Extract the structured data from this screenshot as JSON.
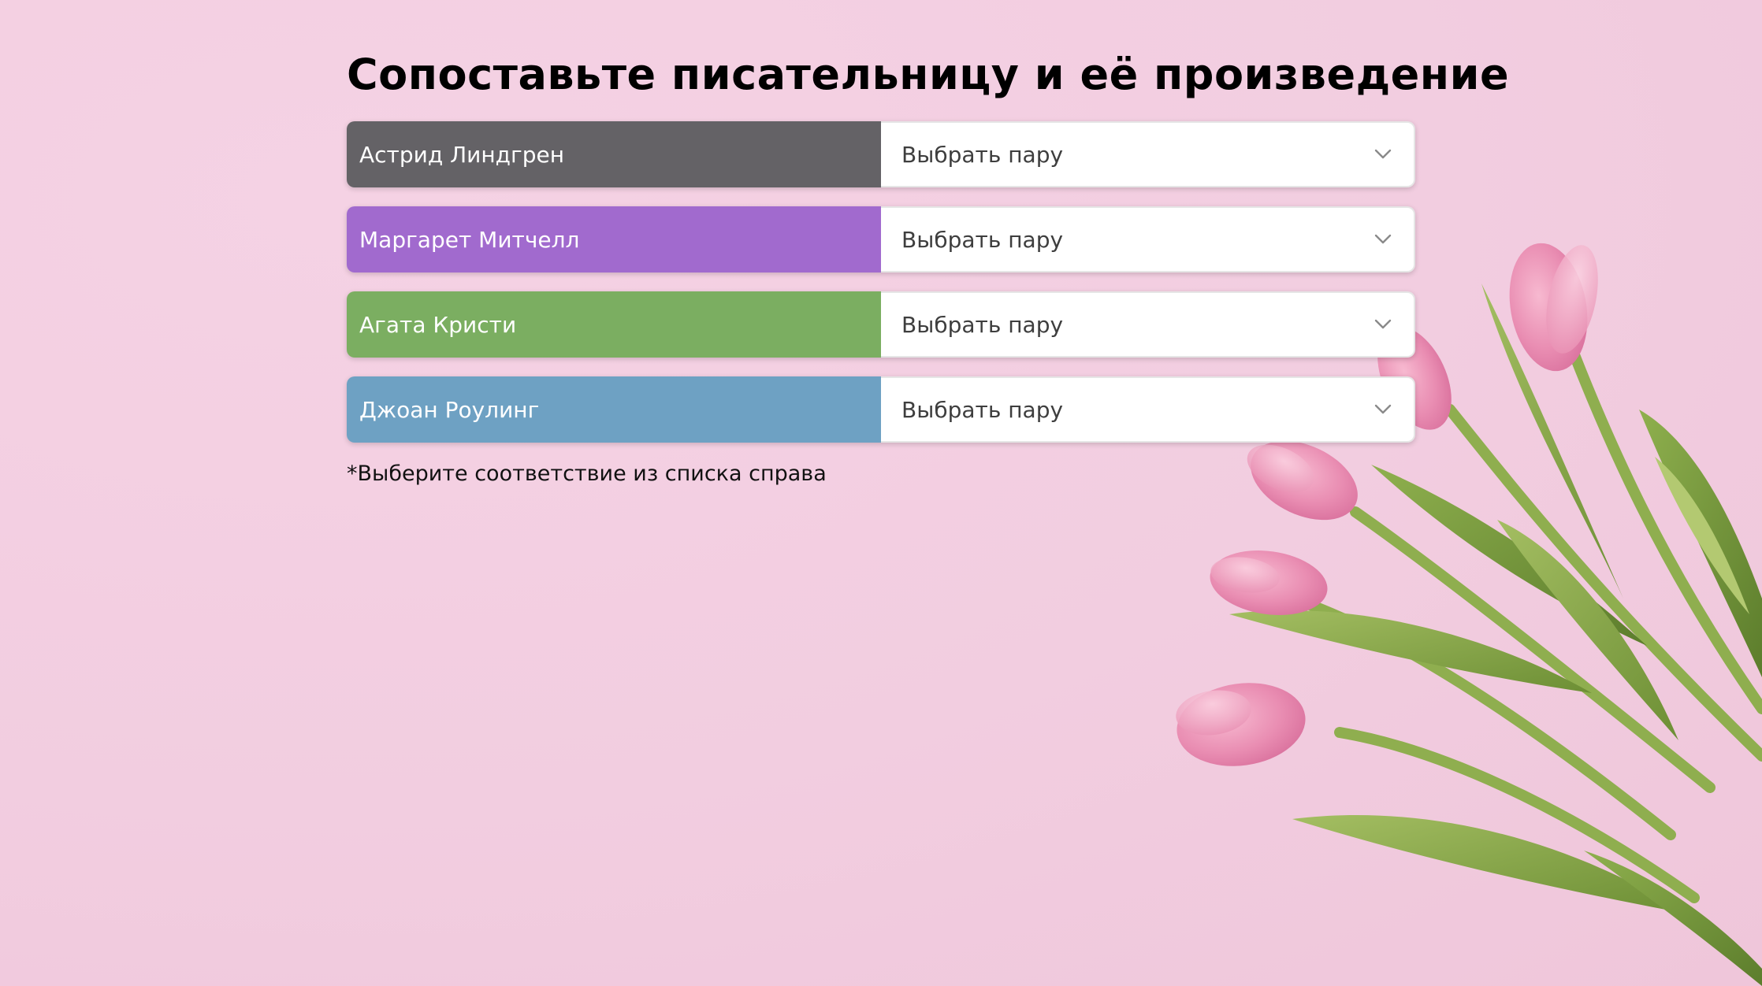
{
  "title": "Сопоставьте писательницу и её произведение",
  "rows": [
    {
      "author": "Астрид Линдгрен",
      "select_value": "Выбрать пару",
      "color": "#646266"
    },
    {
      "author": "Маргарет Митчелл",
      "select_value": "Выбрать пару",
      "color": "#a16ace"
    },
    {
      "author": "Агата Кристи",
      "select_value": "Выбрать пару",
      "color": "#7bae61"
    },
    {
      "author": "Джоан Роулинг",
      "select_value": "Выбрать пару",
      "color": "#6ea1c3"
    }
  ],
  "hint": "*Выберите соответствие из списка справа",
  "icons": {
    "dropdown": "chevron-down-icon"
  },
  "colors": {
    "background": "#f2cde0",
    "select_bg": "#ffffff",
    "text": "#000000"
  }
}
